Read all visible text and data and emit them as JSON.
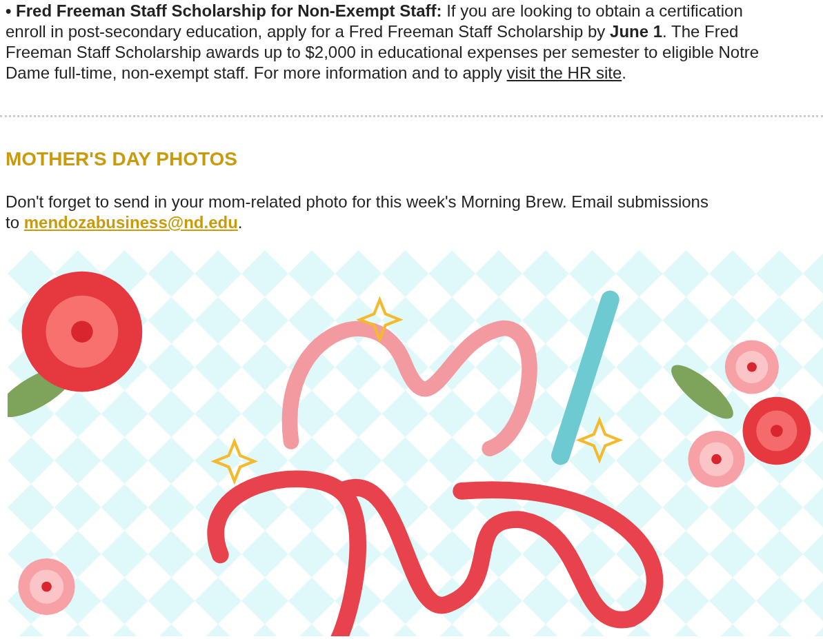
{
  "scholarship_paragraph": {
    "lines": [
      [
        {
          "kind": "bold",
          "text": "• Fred Freeman Staff Scholarship for Non-Exempt Staff:"
        },
        {
          "kind": "text",
          "text": " If you are looking to obtain a certification"
        }
      ],
      [
        {
          "kind": "text",
          "text": "enroll in post-secondary education, apply for a Fred Freeman Staff Scholarship by "
        },
        {
          "kind": "bold",
          "text": "June 1"
        },
        {
          "kind": "text",
          "text": ". The Fred"
        }
      ],
      [
        {
          "kind": "text",
          "text": "Freeman Staff Scholarship awards up to $2,000 in educational expenses per semester to eligible Notre"
        }
      ],
      [
        {
          "kind": "text",
          "text": "Dame full-time, non-exempt staff. For more information and to apply "
        },
        {
          "kind": "link",
          "text": "visit the HR site"
        },
        {
          "kind": "text",
          "text": "."
        }
      ]
    ]
  },
  "section": {
    "heading": "MOTHER'S DAY PHOTOS",
    "lines": [
      [
        {
          "kind": "text",
          "text": "Don't forget to send in your mom-related photo for this week's Morning Brew. Email submissions"
        }
      ],
      [
        {
          "kind": "text",
          "text": "to "
        },
        {
          "kind": "email_link",
          "text": "mendozabusiness@nd.edu"
        },
        {
          "kind": "text",
          "text": "."
        }
      ]
    ],
    "image": {
      "kind": "picture"
    }
  }
}
